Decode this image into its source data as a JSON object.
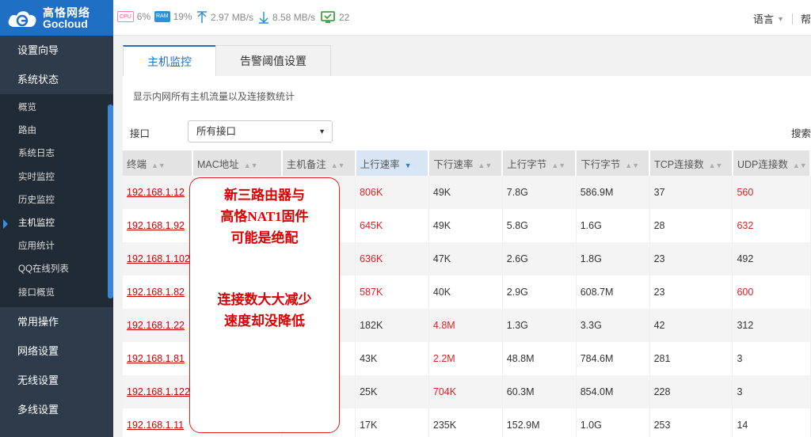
{
  "brand": {
    "name_cn": "高恪网络",
    "name_en": "Gocloud"
  },
  "status": {
    "cpu_chip": "CPU",
    "cpu_value": "6%",
    "ram_chip": "RAM",
    "ram_value": "19%",
    "upload": "2.97 MB/s",
    "download": "8.58 MB/s",
    "connections": "22"
  },
  "top_right": {
    "language": "语言",
    "help": "帮"
  },
  "sidebar": {
    "groups_top": [
      "设置向导",
      "系统状态"
    ],
    "sub_items": [
      "概览",
      "路由",
      "系统日志",
      "实时监控",
      "历史监控",
      "主机监控",
      "应用统计",
      "QQ在线列表",
      "接口概览"
    ],
    "active_sub": "主机监控",
    "groups_bottom": [
      "常用操作",
      "网络设置",
      "无线设置",
      "多线设置"
    ]
  },
  "tabs": [
    "主机监控",
    "告警阈值设置"
  ],
  "description": "显示内网所有主机流量以及连接数统计",
  "filter": {
    "label": "接口",
    "value": "所有接口"
  },
  "search_label": "搜索",
  "table": {
    "headers": [
      "终端",
      "MAC地址",
      "主机备注",
      "上行速率",
      "下行速率",
      "上行字节",
      "下行字节",
      "TCP连接数",
      "UDP连接数"
    ],
    "rows": [
      {
        "ip": "192.168.1.12",
        "up_rate": "806K",
        "down_rate": "49K",
        "up_bytes": "7.8G",
        "down_bytes": "586.9M",
        "tcp": "37",
        "udp": "560"
      },
      {
        "ip": "192.168.1.92",
        "up_rate": "645K",
        "down_rate": "49K",
        "up_bytes": "5.8G",
        "down_bytes": "1.6G",
        "tcp": "28",
        "udp": "632"
      },
      {
        "ip": "192.168.1.102",
        "up_rate": "636K",
        "down_rate": "47K",
        "up_bytes": "2.6G",
        "down_bytes": "1.8G",
        "tcp": "23",
        "udp": "492"
      },
      {
        "ip": "192.168.1.82",
        "up_rate": "587K",
        "down_rate": "40K",
        "up_bytes": "2.9G",
        "down_bytes": "608.7M",
        "tcp": "23",
        "udp": "600"
      },
      {
        "ip": "192.168.1.22",
        "up_rate": "182K",
        "down_rate": "4.8M",
        "up_bytes": "1.3G",
        "down_bytes": "3.3G",
        "tcp": "42",
        "udp": "312"
      },
      {
        "ip": "192.168.1.81",
        "up_rate": "43K",
        "down_rate": "2.2M",
        "up_bytes": "48.8M",
        "down_bytes": "784.6M",
        "tcp": "281",
        "udp": "3"
      },
      {
        "ip": "192.168.1.122",
        "up_rate": "25K",
        "down_rate": "704K",
        "up_bytes": "60.3M",
        "down_bytes": "854.0M",
        "tcp": "228",
        "udp": "3"
      },
      {
        "ip": "192.168.1.11",
        "up_rate": "17K",
        "down_rate": "235K",
        "up_bytes": "152.9M",
        "down_bytes": "1.0G",
        "tcp": "253",
        "udp": "14"
      }
    ]
  },
  "annotation": {
    "lines_1": [
      "新三路由器与",
      "高恪NAT1固件",
      "可能是绝配"
    ],
    "lines_2": [
      "连接数大大减少",
      "速度却没降低"
    ]
  },
  "colors": {
    "brand_blue": "#1f6fc5",
    "sidebar_bg": "#2e3b4a",
    "highlight_red": "#d22"
  }
}
